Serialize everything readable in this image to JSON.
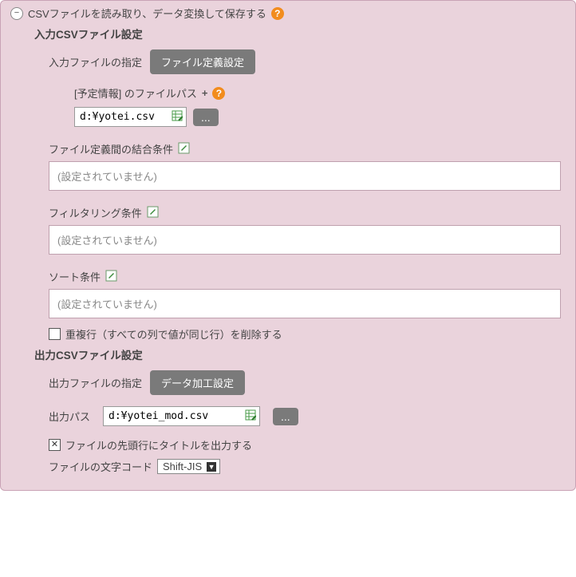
{
  "header": {
    "title": "CSVファイルを読み取り、データ変換して保存する",
    "collapse_glyph": "−"
  },
  "input_section": {
    "title": "入力CSVファイル設定",
    "file_spec_label": "入力ファイルの指定",
    "file_def_button": "ファイル定義設定",
    "file_path_label": "[予定情報] のファイルパス",
    "plus": "+",
    "file_path_value": "d:¥yotei.csv",
    "browse": "...",
    "join_cond_label": "ファイル定義間の結合条件",
    "join_cond_value": "(設定されていません)",
    "filter_label": "フィルタリング条件",
    "filter_value": "(設定されていません)",
    "sort_label": "ソート条件",
    "sort_value": "(設定されていません)",
    "dedup_label": "重複行（すべての列で値が同じ行）を削除する"
  },
  "output_section": {
    "title": "出力CSVファイル設定",
    "file_spec_label": "出力ファイルの指定",
    "transform_button": "データ加工設定",
    "out_path_label": "出力パス",
    "out_path_value": "d:¥yotei_mod.csv",
    "browse": "...",
    "title_row_label": "ファイルの先頭行にタイトルを出力する",
    "encoding_label": "ファイルの文字コード",
    "encoding_value": "Shift-JIS"
  },
  "icons": {
    "help": "?",
    "caret": "▼"
  }
}
